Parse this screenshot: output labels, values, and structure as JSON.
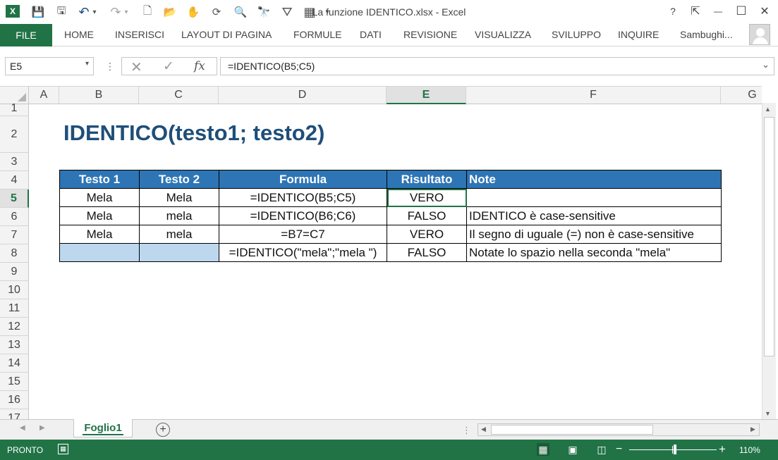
{
  "window": {
    "title": "La funzione IDENTICO.xlsx - Excel",
    "help": "?",
    "restore_ribbon": "⇱",
    "minimize": "—",
    "maximize": "☐",
    "close": "✕"
  },
  "qat": {
    "excel_logo": "X",
    "save": "💾",
    "save_as": "🖫",
    "undo": "↶",
    "undo_dd": "▾",
    "redo": "↷",
    "redo_dd": "▾",
    "new": "🗋",
    "open": "📂",
    "touch": "✋",
    "sync": "⟳",
    "print_preview": "🔍",
    "find": "🔭",
    "filter": "⛛",
    "form": "▦",
    "customize": "▾"
  },
  "ribbon": {
    "file": "FILE",
    "tabs": [
      "HOME",
      "INSERISCI",
      "LAYOUT DI PAGINA",
      "FORMULE",
      "DATI",
      "REVISIONE",
      "VISUALIZZA",
      "SVILUPPO",
      "INQUIRE"
    ],
    "user": "Sambughi..."
  },
  "formula_bar": {
    "name_box": "E5",
    "name_dd": "▾",
    "separator": "⋮",
    "cancel": "✕",
    "enter": "✓",
    "fx": "fx",
    "formula": "=IDENTICO(B5;C5)",
    "expand": "⌄"
  },
  "grid": {
    "columns": [
      "A",
      "B",
      "C",
      "D",
      "E",
      "F",
      "G"
    ],
    "active_column": "E",
    "rows": [
      "1",
      "2",
      "3",
      "4",
      "5",
      "6",
      "7",
      "8",
      "9",
      "10",
      "11",
      "12",
      "13",
      "14",
      "15",
      "16",
      "17"
    ],
    "active_row": "5"
  },
  "sheet": {
    "title": "IDENTICO(testo1; testo2)",
    "table": {
      "headers": [
        "Testo 1",
        "Testo 2",
        "Formula",
        "Risultato",
        "Note"
      ],
      "rows": [
        [
          "Mela",
          "Mela",
          "=IDENTICO(B5;C5)",
          "VERO",
          ""
        ],
        [
          "Mela",
          "mela",
          "=IDENTICO(B6;C6)",
          "FALSO",
          "IDENTICO è case-sensitive"
        ],
        [
          "Mela",
          "mela",
          "=B7=C7",
          "VERO",
          "Il segno di uguale (=) non è case-sensitive"
        ],
        [
          "",
          "",
          "=IDENTICO(\"mela\";\"mela \")",
          "FALSO",
          "Notate lo spazio nella seconda \"mela\""
        ]
      ]
    }
  },
  "tabs_bar": {
    "prev": "◀",
    "next": "▶",
    "sheet_name": "Foglio1",
    "add": "+",
    "split": "⋮"
  },
  "scroll": {
    "up": "▲",
    "down": "▼",
    "left": "◀",
    "right": "▶"
  },
  "status": {
    "ready": "PRONTO",
    "macro": "▦",
    "normal_view": "▦",
    "layout_view": "▣",
    "break_view": "◫",
    "zoom_minus": "−",
    "zoom_plus": "+",
    "zoom": "110%"
  },
  "colors": {
    "excel_green": "#217346",
    "header_blue": "#2e75b6",
    "title_blue": "#1f4e79",
    "blank_cell": "#bdd7ee"
  }
}
